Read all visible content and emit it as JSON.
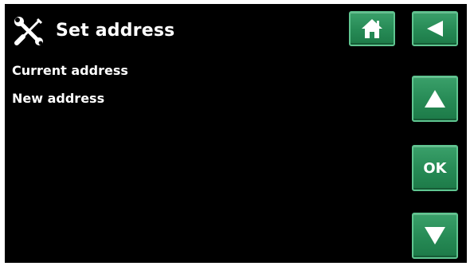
{
  "header": {
    "title": "Set address",
    "tools_icon": "tools-icon"
  },
  "fields": {
    "current_address_label": "Current address",
    "new_address_label": "New address"
  },
  "nav": {
    "home_icon": "home-icon",
    "back_icon": "back-arrow-icon",
    "up_icon": "arrow-up-icon",
    "ok_label": "OK",
    "down_icon": "arrow-down-icon"
  },
  "colors": {
    "background": "#000000",
    "button_green": "#268a55",
    "text": "#ffffff"
  }
}
